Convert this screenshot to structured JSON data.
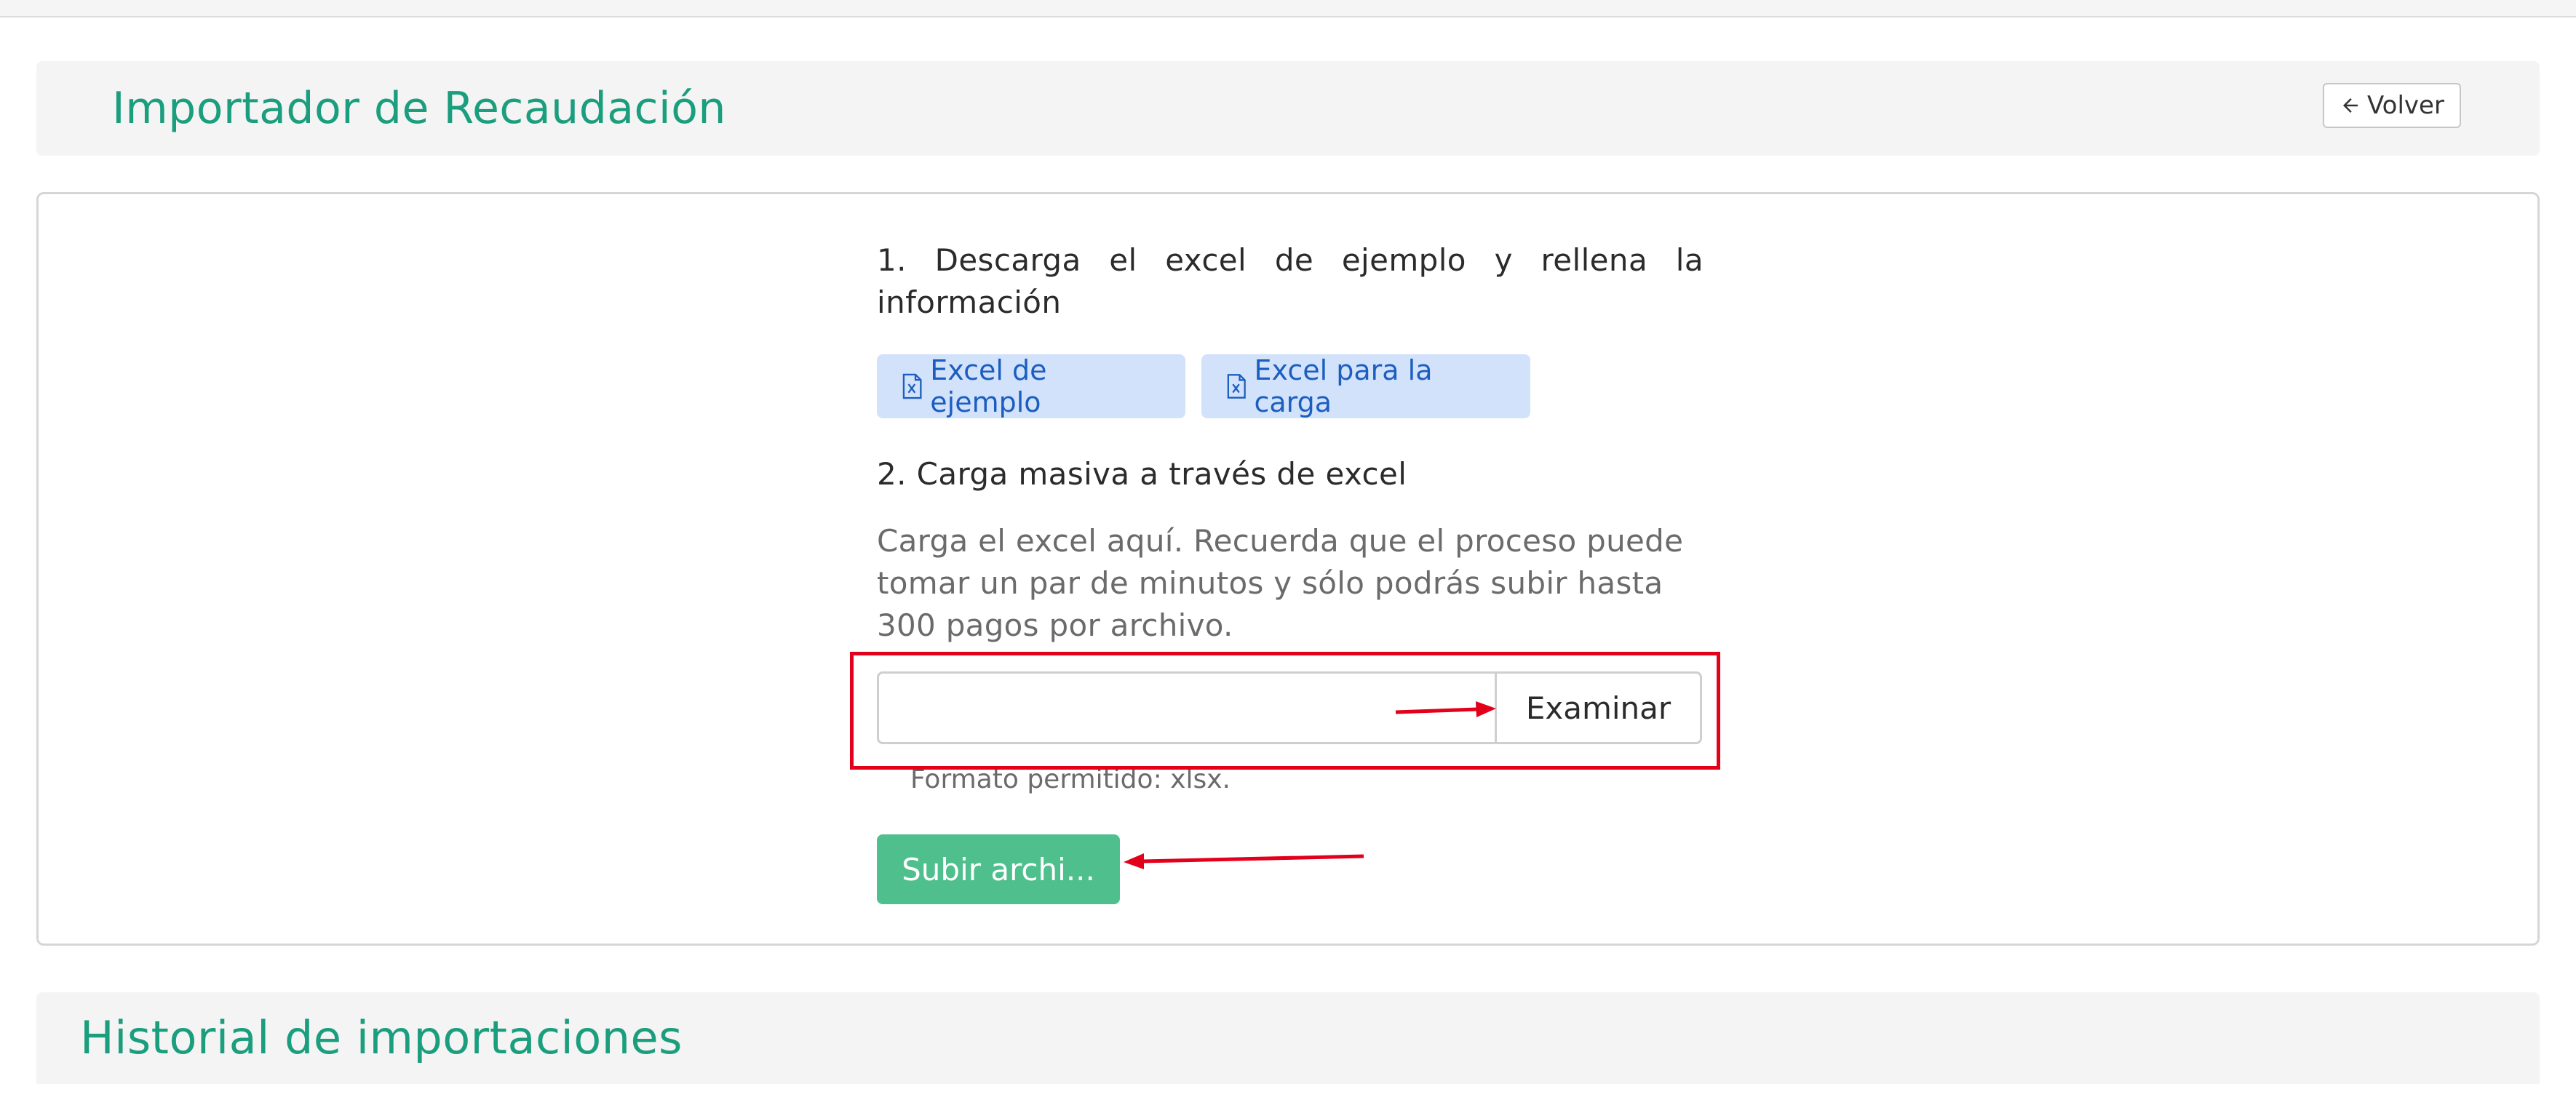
{
  "header": {
    "title": "Importador de Recaudación",
    "back_label": "Volver"
  },
  "importer": {
    "step1_text": "1. Descarga el excel de ejemplo y rellena la información",
    "example_excel_label": "Excel de ejemplo",
    "upload_excel_label": "Excel para la carga",
    "step2_title": "2. Carga masiva a través de excel",
    "help_text": "Carga el excel aquí. Recuerda que el proceso puede tomar un par de minutos y sólo podrás subir hasta 300 pagos por archivo.",
    "file_input_value": "",
    "browse_label": "Examinar",
    "format_note": "Formato permitido: xlsx.",
    "upload_button_label": "Subir archi..."
  },
  "history": {
    "title": "Historial de importaciones"
  },
  "icons": {
    "back": "arrow-left-icon",
    "excel": "file-excel-icon"
  },
  "colors": {
    "accent_green": "#1a9e7d",
    "upload_button": "#4fc08d",
    "download_button_bg": "#d3e2fb",
    "download_button_text": "#1c5ec0",
    "annotation_red": "#e3001b"
  }
}
